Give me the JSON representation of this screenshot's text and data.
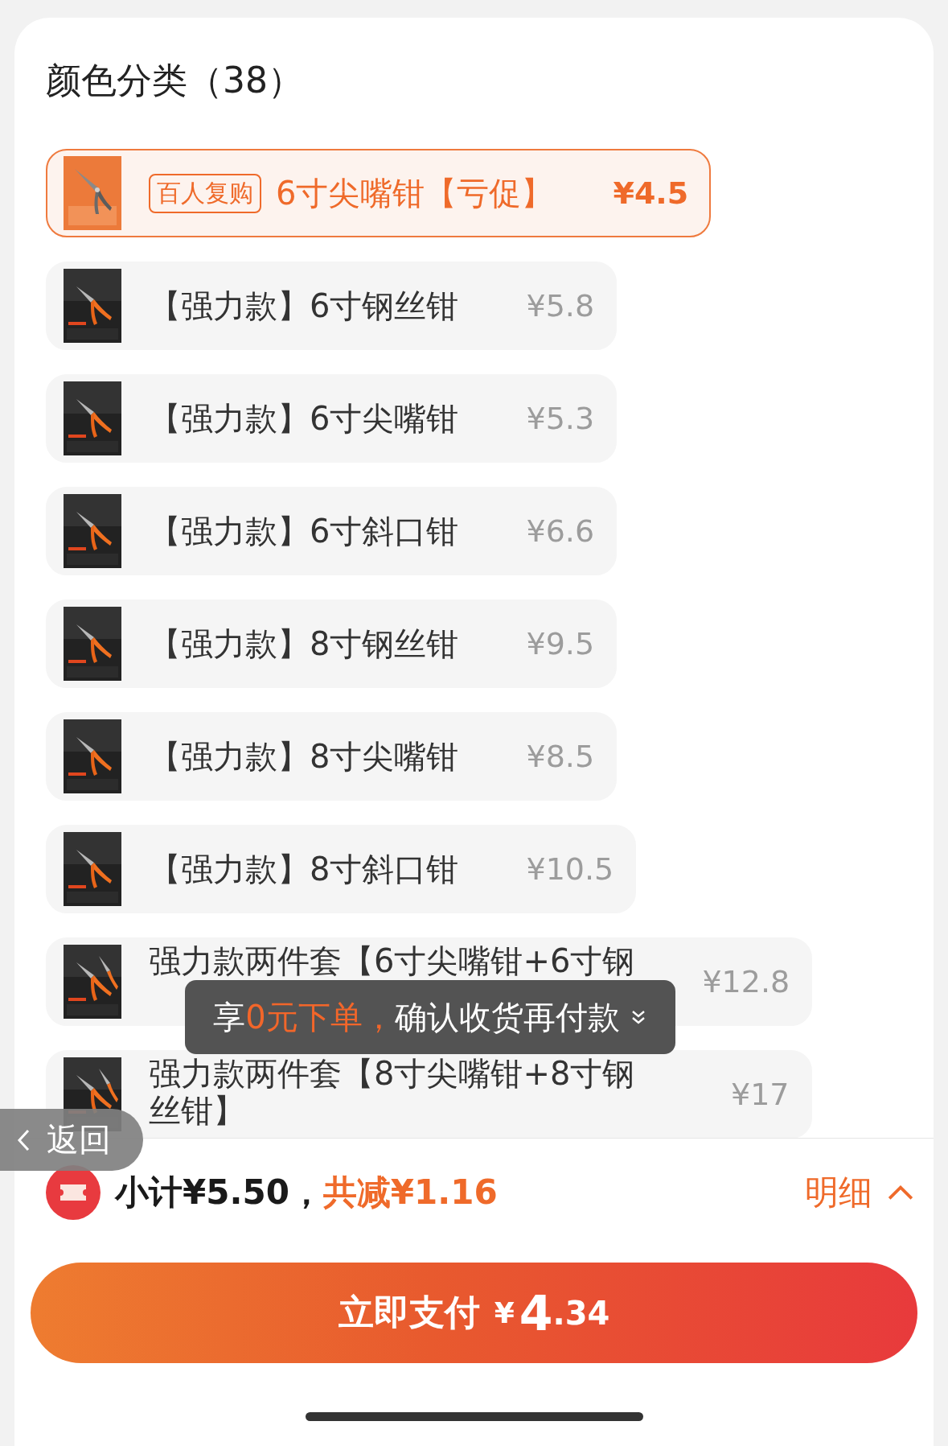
{
  "section": {
    "title": "颜色分类（38）"
  },
  "options": [
    {
      "label": "6寸尖嘴钳【亏促】",
      "tag": "百人复购",
      "price": "¥4.5",
      "selected": true
    },
    {
      "label": "【强力款】6寸钢丝钳",
      "price": "¥5.8",
      "selected": false
    },
    {
      "label": "【强力款】6寸尖嘴钳",
      "price": "¥5.3",
      "selected": false
    },
    {
      "label": "【强力款】6寸斜口钳",
      "price": "¥6.6",
      "selected": false
    },
    {
      "label": "【强力款】8寸钢丝钳",
      "price": "¥9.5",
      "selected": false
    },
    {
      "label": "【强力款】8寸尖嘴钳",
      "price": "¥8.5",
      "selected": false
    },
    {
      "label": "【强力款】8寸斜口钳",
      "price": "¥10.5",
      "selected": false
    },
    {
      "label": "强力款两件套【6寸尖嘴钳+6寸钢",
      "price": "¥12.8",
      "selected": false
    },
    {
      "label": "强力款两件套【8寸尖嘴钳+8寸钢丝钳】",
      "price": "¥17",
      "selected": false
    }
  ],
  "toast": {
    "parts": [
      {
        "text": "享",
        "highlight": false
      },
      {
        "text": "0元下单，",
        "highlight": true
      },
      {
        "text": "确认收货再付款",
        "highlight": false
      }
    ]
  },
  "back_button": {
    "label": "返回"
  },
  "summary": {
    "subtotal": "小计¥5.50，",
    "discount": "共减¥1.16",
    "details_link": "明细"
  },
  "pay_button": {
    "label": "立即支付",
    "currency": "¥",
    "amount_integer": "4",
    "amount_decimal": ".34"
  }
}
